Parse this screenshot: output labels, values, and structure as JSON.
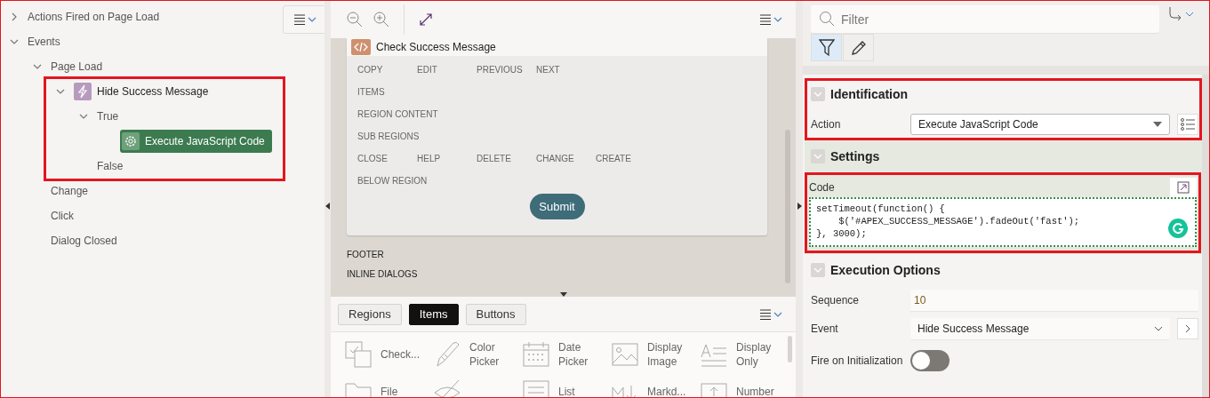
{
  "tree": {
    "nodes": [
      {
        "label": "Actions Fired on Page Load",
        "expanded": false,
        "selected": false
      },
      {
        "label": "Events",
        "expanded": true,
        "selected": false,
        "children": [
          {
            "label": "Page Load",
            "expanded": true,
            "selected": false,
            "children": [
              {
                "label": "Hide Success Message",
                "kind": "dynamic-action",
                "expanded": true,
                "selected": false,
                "annotated": true,
                "children": [
                  {
                    "label": "True",
                    "expanded": true,
                    "selected": false,
                    "children": [
                      {
                        "label": "Execute JavaScript Code",
                        "kind": "js-action",
                        "selected": true
                      }
                    ]
                  },
                  {
                    "label": "False",
                    "selected": false
                  }
                ]
              }
            ]
          },
          {
            "label": "Change",
            "selected": false
          },
          {
            "label": "Click",
            "selected": false
          },
          {
            "label": "Dialog Closed",
            "selected": false
          }
        ]
      }
    ]
  },
  "layout": {
    "region_title": "Check Success Message",
    "position_rows": [
      [
        "COPY",
        "EDIT",
        "PREVIOUS",
        "NEXT"
      ],
      [
        "ITEMS"
      ],
      [
        "REGION CONTENT"
      ],
      [
        "SUB REGIONS"
      ],
      [
        "CLOSE",
        "HELP",
        "DELETE",
        "CHANGE",
        "CREATE"
      ],
      [
        "BELOW REGION"
      ]
    ],
    "button": "Submit",
    "page_positions": [
      "FOOTER",
      "INLINE DIALOGS"
    ]
  },
  "gallery": {
    "tabs": [
      {
        "label": "Regions",
        "selected": false
      },
      {
        "label": "Items",
        "selected": true
      },
      {
        "label": "Buttons",
        "selected": false
      }
    ],
    "items": [
      {
        "kind": "checkbox",
        "label": "Check..."
      },
      {
        "kind": "color-picker",
        "label": "Color Picker"
      },
      {
        "kind": "date-picker",
        "label": "Date Picker"
      },
      {
        "kind": "display-image",
        "label": "Display Image"
      },
      {
        "kind": "display-only",
        "label": "Display Only"
      },
      {
        "kind": "file",
        "label": "File"
      },
      {
        "kind": "hidden"
      },
      {
        "kind": "list",
        "label": "List"
      },
      {
        "kind": "markdown",
        "label": "Markd..."
      },
      {
        "kind": "number",
        "label": "Number"
      }
    ]
  },
  "properties": {
    "filter": {
      "placeholder": "Filter"
    },
    "modes": [
      {
        "kind": "filter",
        "selected": true
      },
      {
        "kind": "edit",
        "selected": false
      }
    ],
    "sections": [
      {
        "title": "Identification",
        "expanded": true,
        "active": false,
        "annotated": true,
        "fields": [
          {
            "kind": "select",
            "label": "Action",
            "value": "Execute JavaScript Code"
          }
        ]
      },
      {
        "title": "Settings",
        "expanded": true,
        "active": true,
        "annotated": false,
        "fields": [
          {
            "kind": "code",
            "label": "Code",
            "annotated": true,
            "value": "setTimeout(function() {\n    $('#APEX_SUCCESS_MESSAGE').fadeOut('fast');\n}, 3000);"
          }
        ]
      },
      {
        "title": "Execution Options",
        "expanded": true,
        "active": false,
        "annotated": false,
        "fields": [
          {
            "kind": "text",
            "label": "Sequence",
            "value": "10"
          },
          {
            "kind": "link-select",
            "label": "Event",
            "value": "Hide Success Message"
          },
          {
            "kind": "switch",
            "label": "Fire on Initialization",
            "on": false
          }
        ]
      }
    ]
  }
}
